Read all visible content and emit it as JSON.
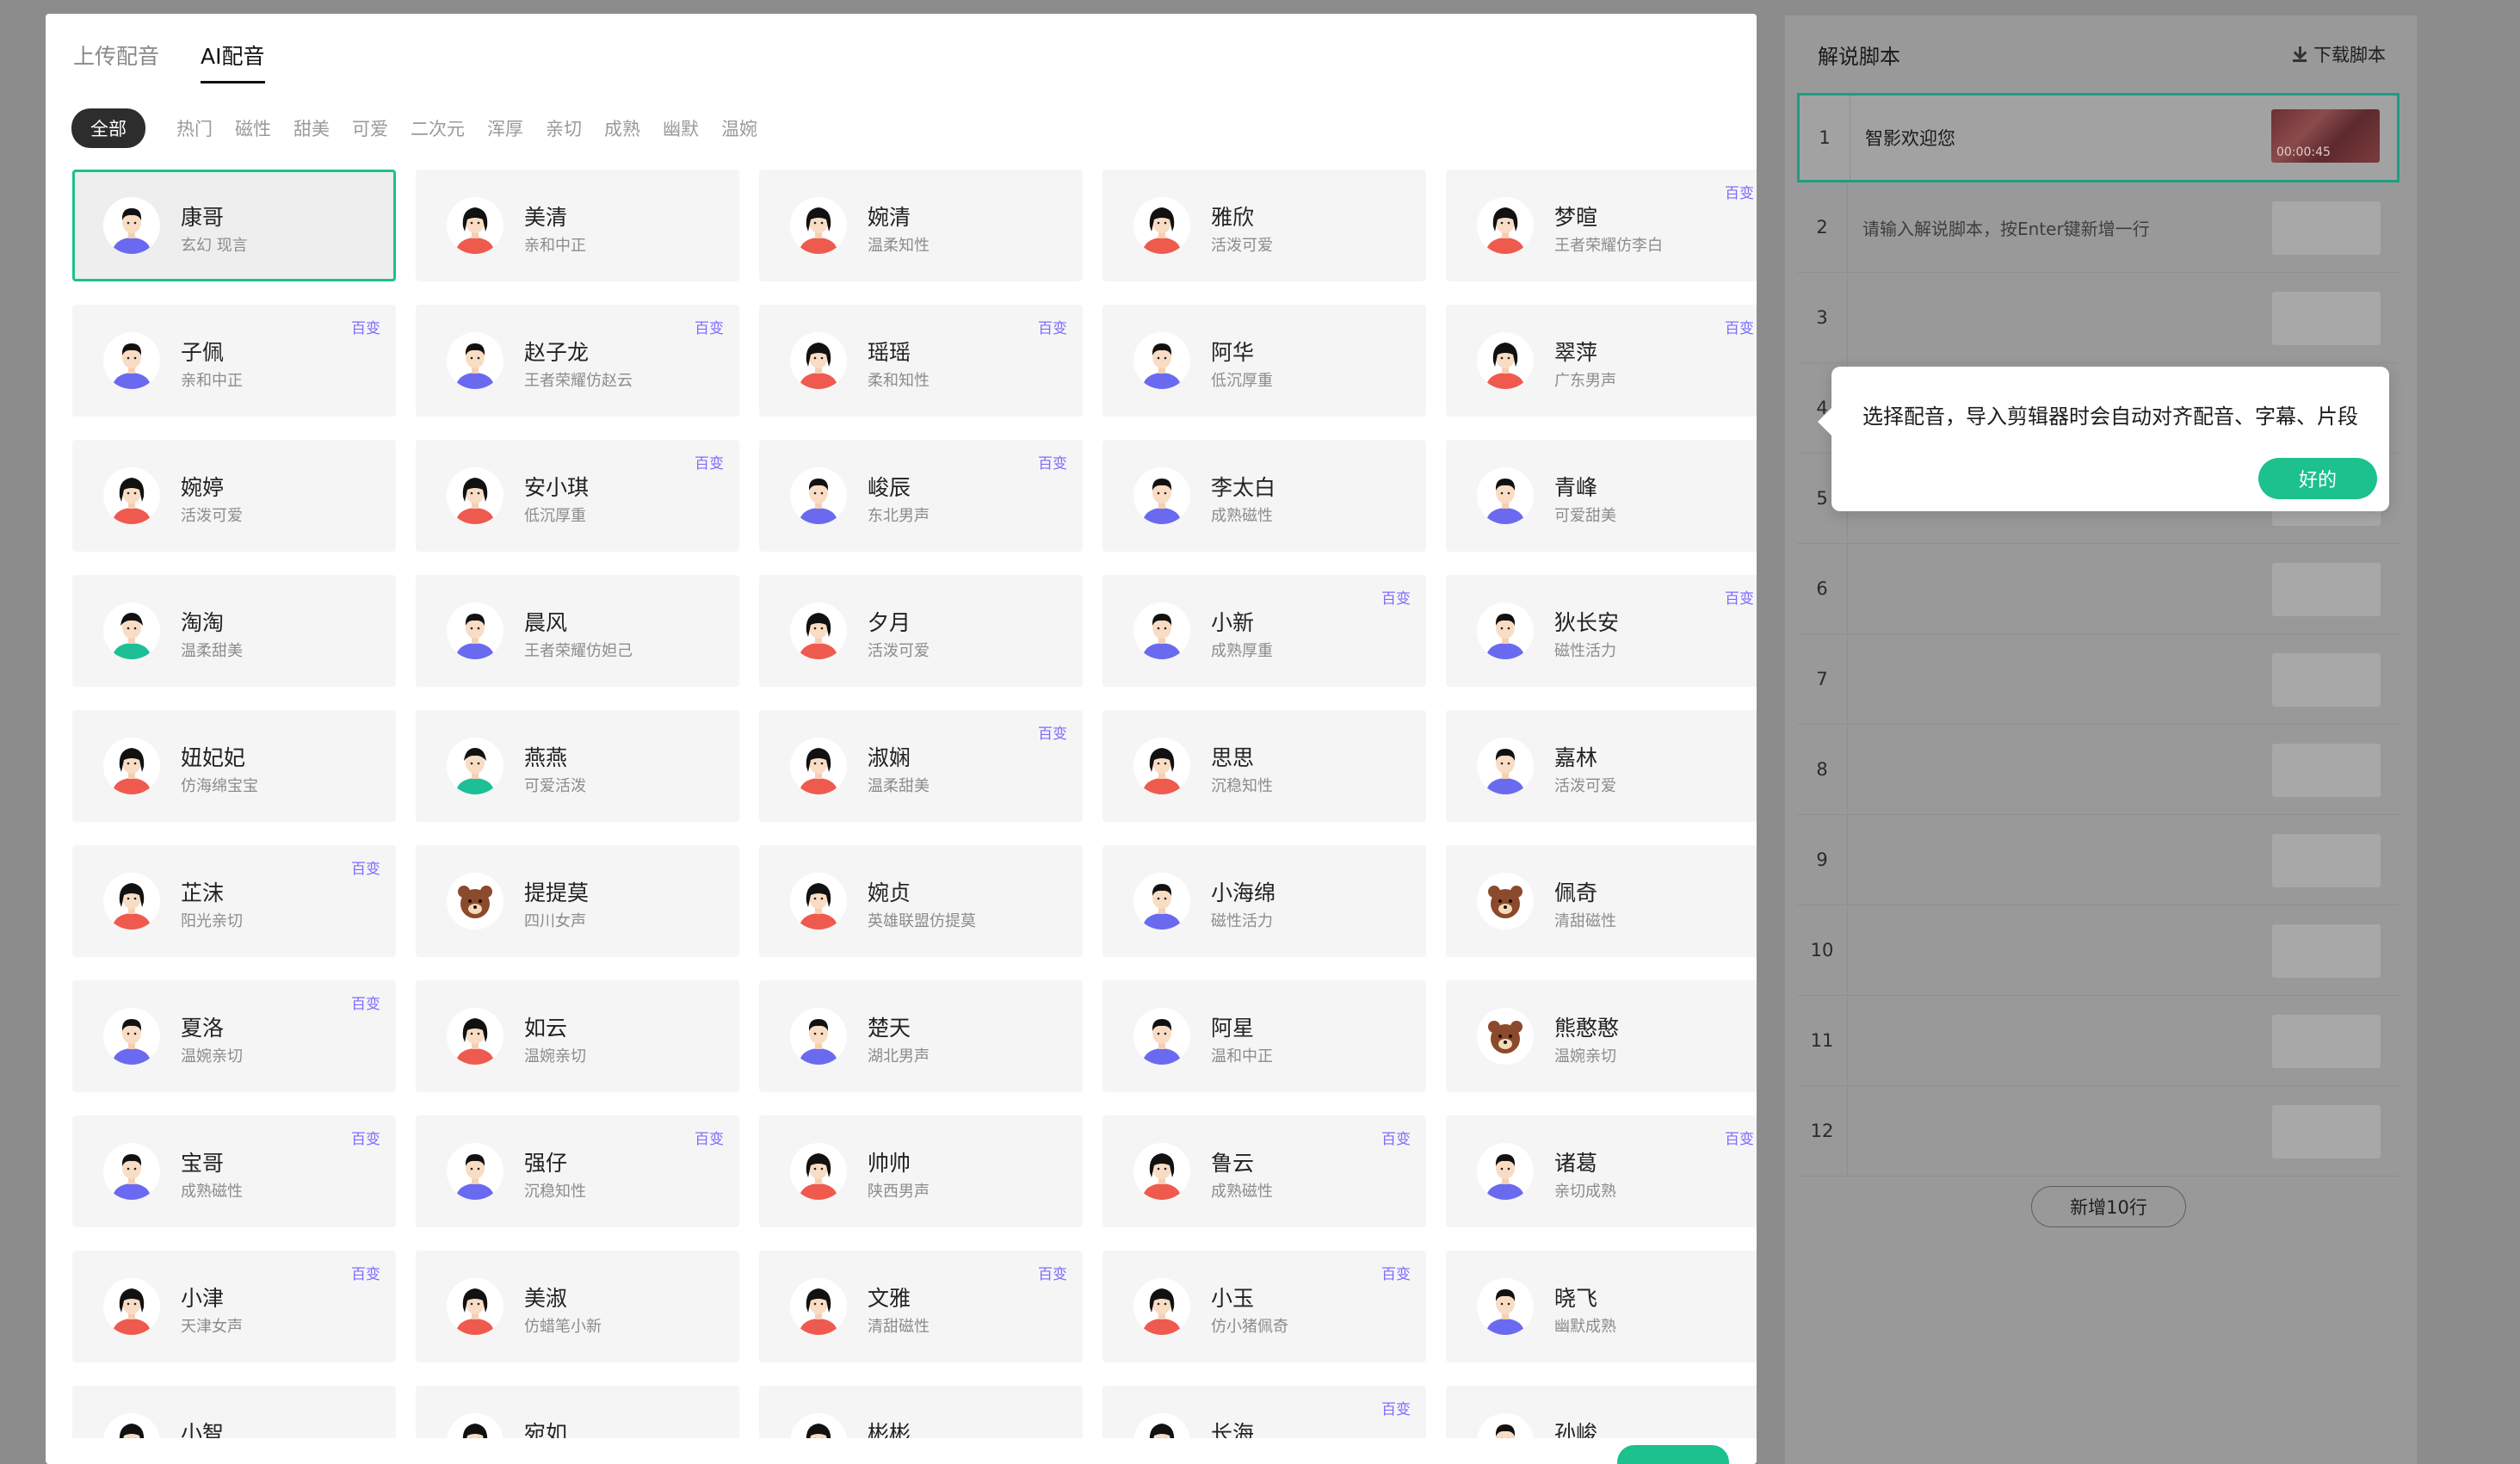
{
  "tabs": [
    "上传配音",
    "AI配音"
  ],
  "active_tab": 1,
  "filters": [
    "全部",
    "热门",
    "磁性",
    "甜美",
    "可爱",
    "二次元",
    "浑厚",
    "亲切",
    "成熟",
    "幽默",
    "温婉"
  ],
  "active_filter": 0,
  "badge_label": "百变",
  "voices": [
    {
      "name": "康哥",
      "desc": "玄幻 现言",
      "avatar": "male-icon",
      "badge": false,
      "selected": true
    },
    {
      "name": "美清",
      "desc": "亲和中正",
      "avatar": "female-icon",
      "badge": false
    },
    {
      "name": "婉清",
      "desc": "温柔知性",
      "avatar": "female-icon",
      "badge": false
    },
    {
      "name": "雅欣",
      "desc": "活泼可爱",
      "avatar": "female-icon",
      "badge": false
    },
    {
      "name": "梦暄",
      "desc": "王者荣耀仿李白",
      "avatar": "female-icon",
      "badge": true
    },
    {
      "name": "子佩",
      "desc": "亲和中正",
      "avatar": "male-icon",
      "badge": true
    },
    {
      "name": "赵子龙",
      "desc": "王者荣耀仿赵云",
      "avatar": "male-icon",
      "badge": true
    },
    {
      "name": "瑶瑶",
      "desc": "柔和知性",
      "avatar": "female-icon",
      "badge": true
    },
    {
      "name": "阿华",
      "desc": "低沉厚重",
      "avatar": "male-icon",
      "badge": false
    },
    {
      "name": "翠萍",
      "desc": "广东男声",
      "avatar": "female-icon",
      "badge": true
    },
    {
      "name": "婉婷",
      "desc": "活泼可爱",
      "avatar": "female-icon",
      "badge": false
    },
    {
      "name": "安小琪",
      "desc": "低沉厚重",
      "avatar": "female-icon",
      "badge": true
    },
    {
      "name": "峻辰",
      "desc": "东北男声",
      "avatar": "male-icon",
      "badge": true
    },
    {
      "name": "李太白",
      "desc": "成熟磁性",
      "avatar": "male-icon",
      "badge": false
    },
    {
      "name": "青峰",
      "desc": "可爱甜美",
      "avatar": "male-icon",
      "badge": false
    },
    {
      "name": "淘淘",
      "desc": "温柔甜美",
      "avatar": "child-icon",
      "badge": false
    },
    {
      "name": "晨风",
      "desc": "王者荣耀仿妲己",
      "avatar": "male-icon",
      "badge": false
    },
    {
      "name": "夕月",
      "desc": "活泼可爱",
      "avatar": "female-icon",
      "badge": false
    },
    {
      "name": "小新",
      "desc": "成熟厚重",
      "avatar": "male-icon",
      "badge": true
    },
    {
      "name": "狄长安",
      "desc": "磁性活力",
      "avatar": "male-icon",
      "badge": true
    },
    {
      "name": "妞妃妃",
      "desc": "仿海绵宝宝",
      "avatar": "female-icon",
      "badge": false
    },
    {
      "name": "燕燕",
      "desc": "可爱活泼",
      "avatar": "child-icon",
      "badge": false
    },
    {
      "name": "淑娴",
      "desc": "温柔甜美",
      "avatar": "female-icon",
      "badge": true
    },
    {
      "name": "思思",
      "desc": "沉稳知性",
      "avatar": "female-icon",
      "badge": false
    },
    {
      "name": "嘉林",
      "desc": "活泼可爱",
      "avatar": "male-icon",
      "badge": false
    },
    {
      "name": "芷沫",
      "desc": "阳光亲切",
      "avatar": "female-icon",
      "badge": true
    },
    {
      "name": "提提莫",
      "desc": "四川女声",
      "avatar": "bear-icon",
      "badge": false
    },
    {
      "name": "婉贞",
      "desc": "英雄联盟仿提莫",
      "avatar": "female-icon",
      "badge": false
    },
    {
      "name": "小海绵",
      "desc": "磁性活力",
      "avatar": "male-icon",
      "badge": false
    },
    {
      "name": "佩奇",
      "desc": "清甜磁性",
      "avatar": "bear-icon",
      "badge": false
    },
    {
      "name": "夏洛",
      "desc": "温婉亲切",
      "avatar": "male-icon",
      "badge": true
    },
    {
      "name": "如云",
      "desc": "温婉亲切",
      "avatar": "female-icon",
      "badge": false
    },
    {
      "name": "楚天",
      "desc": "湖北男声",
      "avatar": "male-icon",
      "badge": false
    },
    {
      "name": "阿星",
      "desc": "温和中正",
      "avatar": "male-icon",
      "badge": false
    },
    {
      "name": "熊憨憨",
      "desc": "温婉亲切",
      "avatar": "bear-icon",
      "badge": false
    },
    {
      "name": "宝哥",
      "desc": "成熟磁性",
      "avatar": "male-icon",
      "badge": true
    },
    {
      "name": "强仔",
      "desc": "沉稳知性",
      "avatar": "male-icon",
      "badge": true
    },
    {
      "name": "帅帅",
      "desc": "陕西男声",
      "avatar": "female-icon",
      "badge": false
    },
    {
      "name": "鲁云",
      "desc": "成熟磁性",
      "avatar": "female-icon",
      "badge": true
    },
    {
      "name": "诸葛",
      "desc": "亲切成熟",
      "avatar": "male-icon",
      "badge": true
    },
    {
      "name": "小津",
      "desc": "天津女声",
      "avatar": "female-icon",
      "badge": true
    },
    {
      "name": "美淑",
      "desc": "仿蜡笔小新",
      "avatar": "female-icon",
      "badge": false
    },
    {
      "name": "文雅",
      "desc": "清甜磁性",
      "avatar": "female-icon",
      "badge": true
    },
    {
      "name": "小玉",
      "desc": "仿小猪佩奇",
      "avatar": "female-icon",
      "badge": true
    },
    {
      "name": "晓飞",
      "desc": "幽默成熟",
      "avatar": "male-icon",
      "badge": false
    },
    {
      "name": "小智",
      "desc": "",
      "avatar": "female-icon",
      "badge": false
    },
    {
      "name": "宛如",
      "desc": "",
      "avatar": "female-icon",
      "badge": false
    },
    {
      "name": "彬彬",
      "desc": "",
      "avatar": "female-icon",
      "badge": false
    },
    {
      "name": "长海",
      "desc": "",
      "avatar": "female-icon",
      "badge": true
    },
    {
      "name": "孙峻",
      "desc": "",
      "avatar": "male-icon",
      "badge": false
    }
  ],
  "script_panel": {
    "title": "解说脚本",
    "download_label": "下载脚本",
    "rows": [
      {
        "num": "1",
        "text": "智影欢迎您",
        "duration": "00:00:45"
      },
      {
        "num": "2",
        "text": "请输入解说脚本，按Enter键新增一行"
      },
      {
        "num": "3",
        "text": ""
      },
      {
        "num": "4",
        "text": ""
      },
      {
        "num": "5",
        "text": ""
      },
      {
        "num": "6",
        "text": ""
      },
      {
        "num": "7",
        "text": ""
      },
      {
        "num": "8",
        "text": ""
      },
      {
        "num": "9",
        "text": ""
      },
      {
        "num": "10",
        "text": ""
      },
      {
        "num": "11",
        "text": ""
      },
      {
        "num": "12",
        "text": ""
      }
    ],
    "add_rows_label": "新增10行"
  },
  "tooltip": {
    "text": "选择配音，导入剪辑器时会自动对齐配音、字幕、片段",
    "button": "好的"
  },
  "colors": {
    "accent": "#1cc18d",
    "badge": "#7b6cff",
    "male": "#6a6af0",
    "female": "#ef5a4f",
    "child": "#1dbf96",
    "bear": "#8b4a2b"
  }
}
